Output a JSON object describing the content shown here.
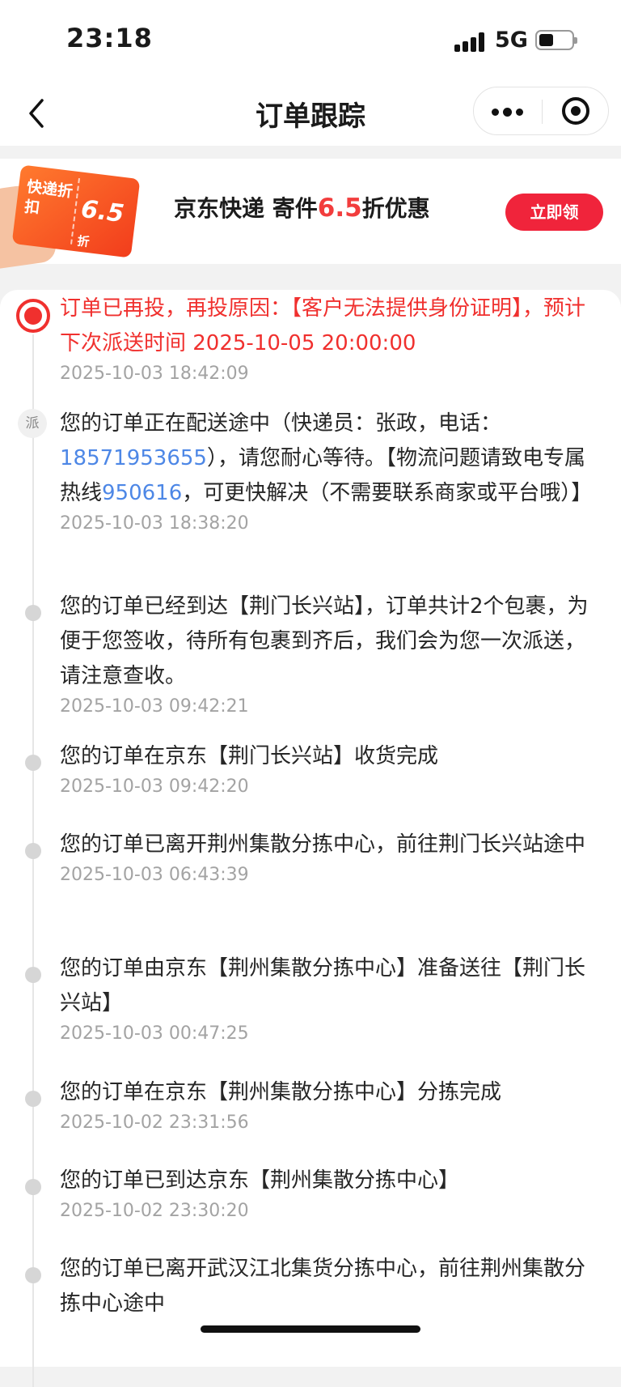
{
  "status_bar": {
    "time": "23:18",
    "network": "5G"
  },
  "nav": {
    "title": "订单跟踪"
  },
  "banner": {
    "coupon_label": "快递折扣",
    "coupon_value": "6.5",
    "coupon_unit": "折",
    "text_before": "京东快递  寄件",
    "text_highlight": "6.5",
    "text_after": "折优惠",
    "button_label": "立即领"
  },
  "tracking": {
    "dispatch_badge": "派",
    "events": [
      {
        "message": "订单已再投，再投原因：【客户无法提供身份证明】，预计下次派送时间 2025-10-05 20:00:00",
        "time": "2025-10-03 18:42:09"
      },
      {
        "message_part1": "您的订单正在配送途中（快递员：张政，电话：",
        "phone": "18571953655",
        "message_part2": "），请您耐心等待。【物流问题请致电专属热线",
        "hotline": "950616",
        "message_part3": "，可更快解决（不需要联系商家或平台哦）】",
        "time": "2025-10-03 18:38:20"
      },
      {
        "message": "您的订单已经到达【荆门长兴站】，订单共计2个包裹，为便于您签收，待所有包裹到齐后，我们会为您一次派送，请注意查收。",
        "time": "2025-10-03 09:42:21"
      },
      {
        "message": "您的订单在京东【荆门长兴站】收货完成",
        "time": "2025-10-03 09:42:20"
      },
      {
        "message": "您的订单已离开荆州集散分拣中心，前往荆门长兴站途中",
        "time": "2025-10-03 06:43:39"
      },
      {
        "message": "您的订单由京东【荆州集散分拣中心】准备送往【荆门长兴站】",
        "time": "2025-10-03 00:47:25"
      },
      {
        "message": "您的订单在京东【荆州集散分拣中心】分拣完成",
        "time": "2025-10-02 23:31:56"
      },
      {
        "message": "您的订单已到达京东【荆州集散分拣中心】",
        "time": "2025-10-02 23:30:20"
      },
      {
        "message": "您的订单已离开武汉江北集货分拣中心，前往荆州集散分拣中心途中",
        "time": ""
      }
    ]
  }
}
